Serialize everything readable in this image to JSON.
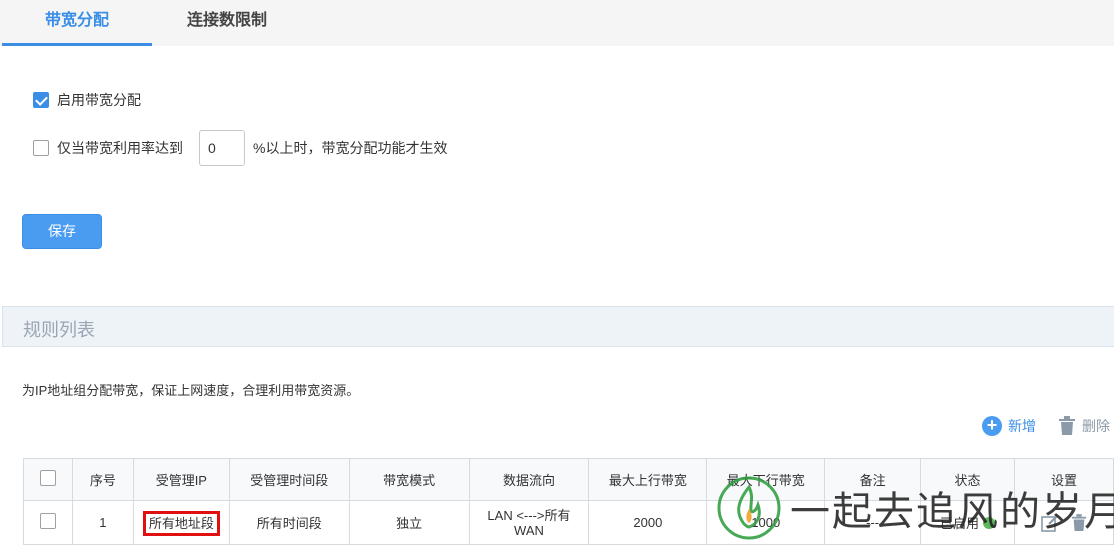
{
  "tabs": [
    {
      "label": "带宽分配",
      "active": true
    },
    {
      "label": "连接数限制",
      "active": false
    }
  ],
  "settings": {
    "enable_label": "启用带宽分配",
    "enable_checked": true,
    "threshold_prefix": "仅当带宽利用率达到",
    "threshold_value": "0",
    "threshold_suffix": "%以上时，带宽分配功能才生效",
    "threshold_checked": false,
    "save_label": "保存"
  },
  "rules": {
    "section_title": "规则列表",
    "description": "为IP地址组分配带宽，保证上网速度，合理利用带宽资源。",
    "add_label": "新增",
    "delete_label": "删除",
    "columns": [
      "序号",
      "受管理IP",
      "受管理时间段",
      "带宽模式",
      "数据流向",
      "最大上行带宽",
      "最大下行带宽",
      "备注",
      "状态",
      "设置"
    ],
    "rows": [
      {
        "index": "1",
        "ip": "所有地址段",
        "time": "所有时间段",
        "mode": "独立",
        "flow_line1": "LAN <--->所有",
        "flow_line2": "WAN",
        "up": "2000",
        "down": "1000",
        "note": "---",
        "status": "已启用"
      }
    ]
  },
  "watermark": {
    "text": "一起去追风的岁月"
  },
  "colors": {
    "accent": "#3a8ee6",
    "highlight_box": "#e01010",
    "status_ok": "#5cb85c"
  }
}
